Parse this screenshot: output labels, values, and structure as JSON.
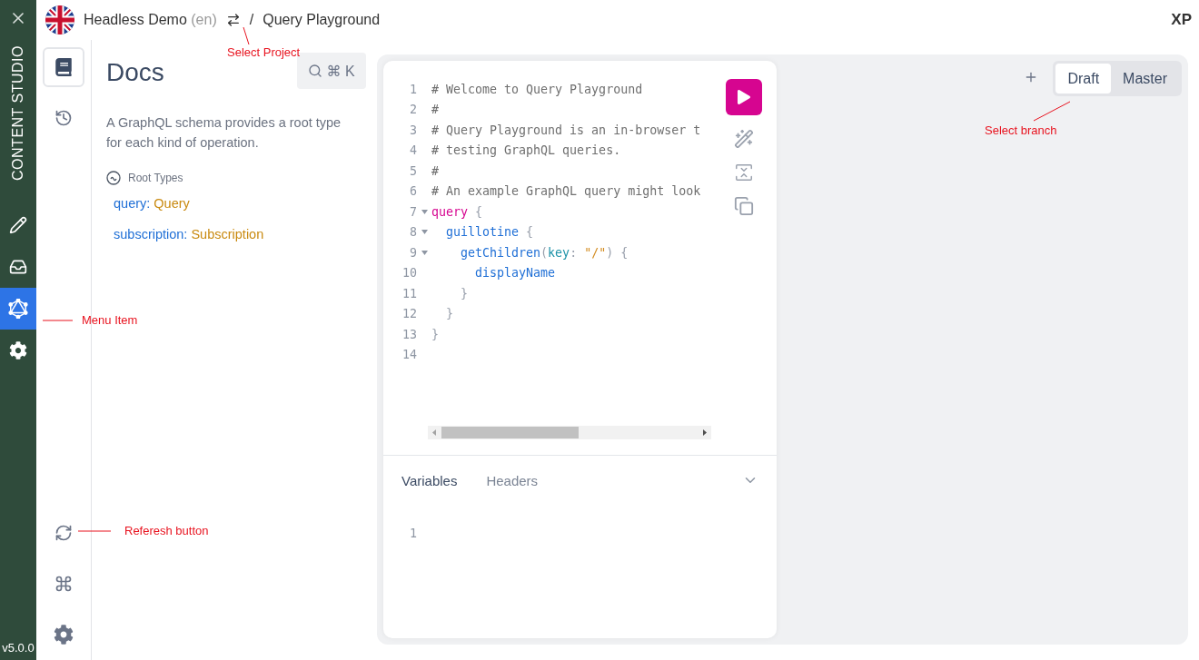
{
  "header": {
    "project": "Headless Demo",
    "language": "(en)",
    "separator": "/",
    "page": "Query Playground",
    "brand": "XP"
  },
  "rail": {
    "title": "CONTENT STUDIO",
    "items": [
      {
        "kind": "pencil",
        "selected": false
      },
      {
        "kind": "inbox",
        "selected": false
      },
      {
        "kind": "graphql",
        "selected": true
      },
      {
        "kind": "gear",
        "selected": false
      }
    ],
    "version": "v5.0.0"
  },
  "tool_column": {
    "top": [
      {
        "kind": "book",
        "selected": true
      },
      {
        "kind": "history",
        "selected": false
      }
    ],
    "bottom": [
      {
        "kind": "refresh"
      },
      {
        "kind": "command"
      },
      {
        "kind": "gear"
      }
    ]
  },
  "docs": {
    "title": "Docs",
    "shortcut": "⌘ K",
    "description": "A GraphQL schema provides a root type for each kind of operation.",
    "section": "Root Types",
    "root_types": [
      {
        "field": "query:",
        "type": "Query"
      },
      {
        "field": "subscription:",
        "type": "Subscription"
      }
    ]
  },
  "editor": {
    "lines": [
      {
        "number": "1",
        "foldable": false,
        "tokens": [
          {
            "kind": "comment",
            "text": "# Welcome to Query Playground"
          }
        ]
      },
      {
        "number": "2",
        "foldable": false,
        "tokens": [
          {
            "kind": "comment",
            "text": "#"
          }
        ]
      },
      {
        "number": "3",
        "foldable": false,
        "tokens": [
          {
            "kind": "comment",
            "text": "# Query Playground is an in-browser t"
          }
        ]
      },
      {
        "number": "4",
        "foldable": false,
        "tokens": [
          {
            "kind": "comment",
            "text": "# testing GraphQL queries."
          }
        ]
      },
      {
        "number": "5",
        "foldable": false,
        "tokens": [
          {
            "kind": "comment",
            "text": "#"
          }
        ]
      },
      {
        "number": "6",
        "foldable": false,
        "tokens": [
          {
            "kind": "comment",
            "text": "# An example GraphQL query might look"
          }
        ]
      },
      {
        "number": "7",
        "foldable": true,
        "tokens": [
          {
            "kind": "keyword",
            "text": "query"
          },
          {
            "kind": "punct",
            "text": " {"
          }
        ]
      },
      {
        "number": "8",
        "foldable": true,
        "tokens": [
          {
            "kind": "field",
            "text": "  guillotine"
          },
          {
            "kind": "punct",
            "text": " {"
          }
        ]
      },
      {
        "number": "9",
        "foldable": true,
        "tokens": [
          {
            "kind": "field",
            "text": "    getChildren"
          },
          {
            "kind": "punct",
            "text": "("
          },
          {
            "kind": "arg",
            "text": "key"
          },
          {
            "kind": "punct",
            "text": ": "
          },
          {
            "kind": "string",
            "text": "\"/\""
          },
          {
            "kind": "punct",
            "text": ") {"
          }
        ]
      },
      {
        "number": "10",
        "foldable": false,
        "tokens": [
          {
            "kind": "field",
            "text": "      displayName"
          }
        ]
      },
      {
        "number": "11",
        "foldable": false,
        "tokens": [
          {
            "kind": "punct",
            "text": "    }"
          }
        ]
      },
      {
        "number": "12",
        "foldable": false,
        "tokens": [
          {
            "kind": "punct",
            "text": "  }"
          }
        ]
      },
      {
        "number": "13",
        "foldable": false,
        "tokens": [
          {
            "kind": "punct",
            "text": "}"
          }
        ]
      },
      {
        "number": "14",
        "foldable": false
      }
    ],
    "bottom_tabs": [
      {
        "label": "Variables",
        "selected": true
      },
      {
        "label": "Headers",
        "selected": false
      }
    ],
    "variable_lines": [
      {
        "number": "1"
      }
    ]
  },
  "branches": [
    {
      "label": "Draft",
      "selected": true
    },
    {
      "label": "Master",
      "selected": false
    }
  ],
  "annotations": [
    {
      "text": "Select Project"
    },
    {
      "text": "Select branch"
    },
    {
      "text": "Menu Item"
    },
    {
      "text": "Referesh button"
    }
  ]
}
